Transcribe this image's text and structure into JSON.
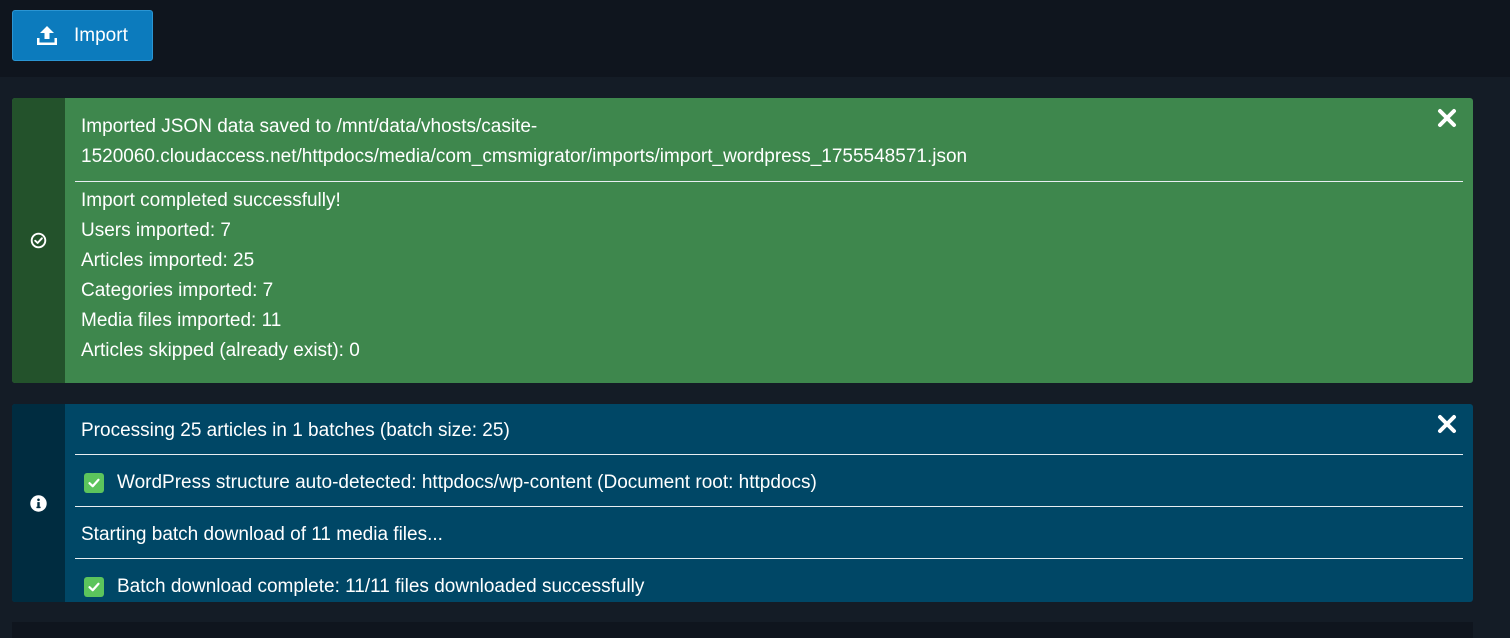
{
  "toolbar": {
    "import_label": "Import",
    "import_icon": "upload-icon"
  },
  "colors": {
    "primary_button": "#0c7bbd",
    "success": "#3e874d",
    "success_side": "#23522b",
    "info": "#004766",
    "info_side": "#002c40",
    "check": "#5cc45c"
  },
  "success_alert": {
    "icon": "check-circle-icon",
    "header_line_1": "Imported JSON data saved to /mnt/data/vhosts/casite-",
    "header_line_2": "1520060.cloudaccess.net/httpdocs/media/com_cmsmigrator/imports/import_wordpress_1755548571.json",
    "lines": [
      "Import completed successfully!",
      "Users imported: 7",
      "Articles imported: 25",
      "Categories imported: 7",
      "Media files imported: 11",
      "Articles skipped (already exist): 0"
    ]
  },
  "info_alert": {
    "icon": "info-circle-icon",
    "messages": [
      "Processing 25 articles in 1 batches (batch size: 25)",
      "WordPress structure auto-detected: httpdocs/wp-content (Document root: httpdocs)",
      "Starting batch download of 11 media files...",
      "Batch download complete: 11/11 files downloaded successfully"
    ]
  }
}
